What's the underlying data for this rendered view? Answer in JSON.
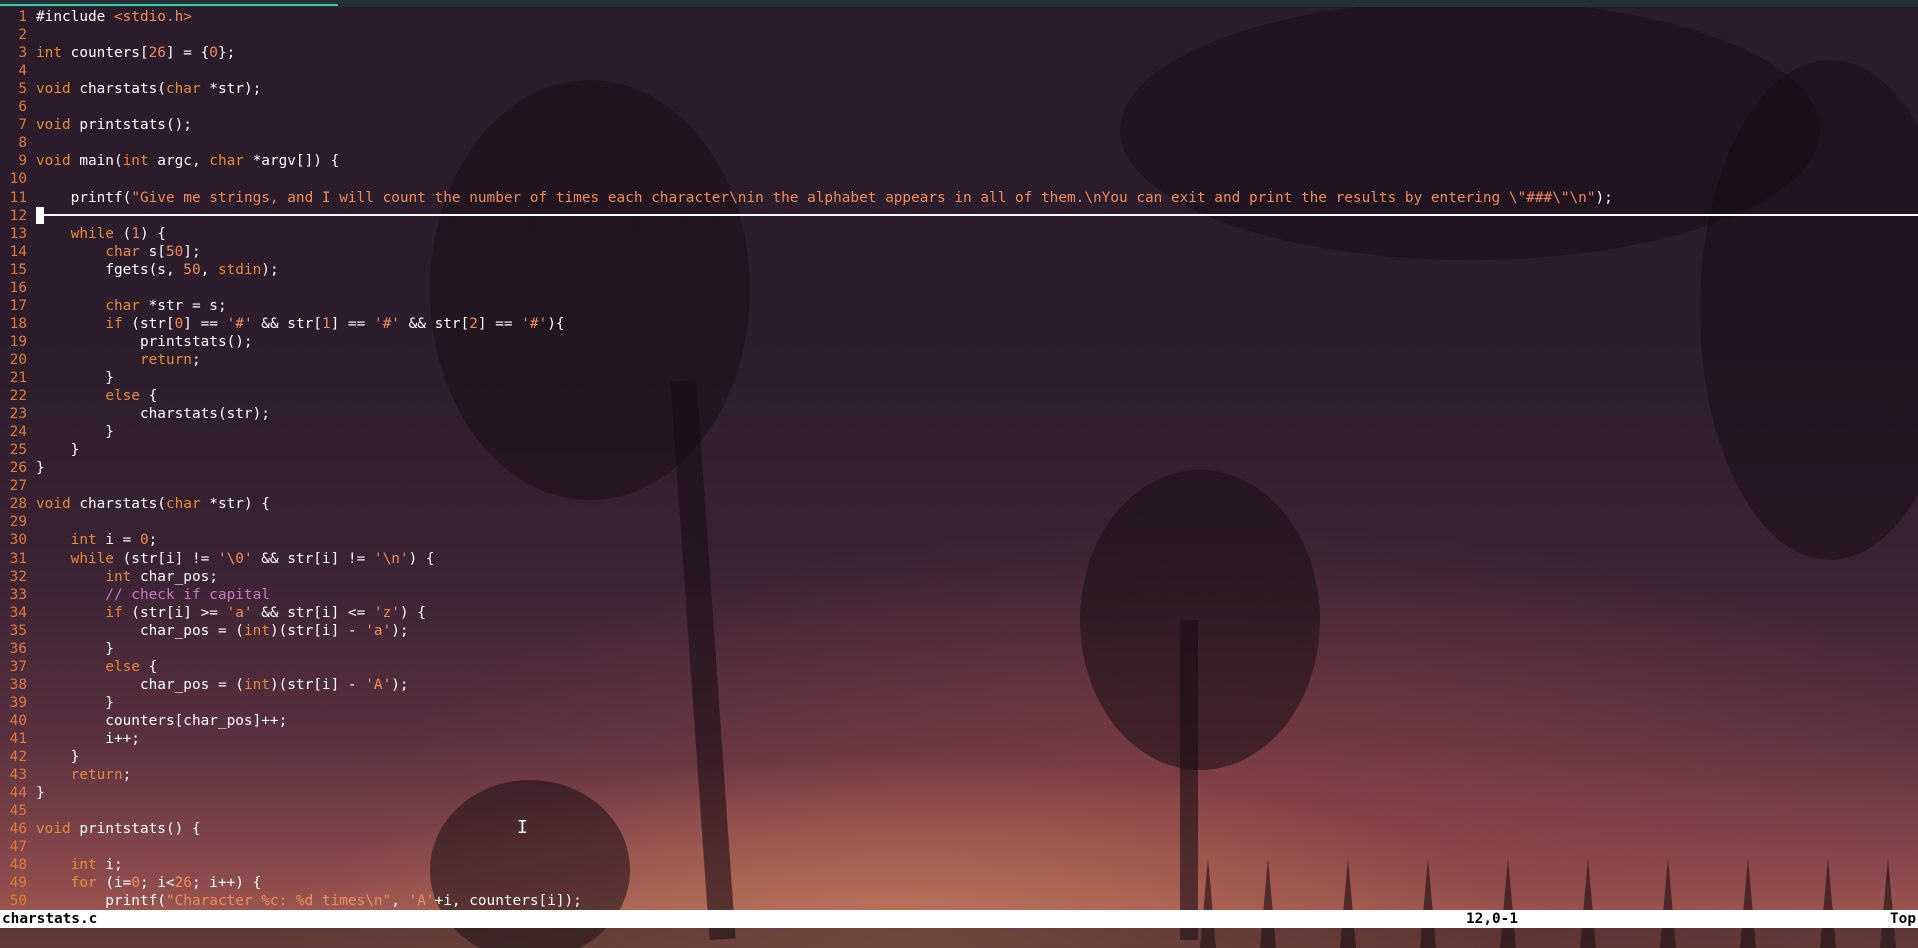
{
  "editor": {
    "lines": [
      {
        "n": "1",
        "segs": [
          [
            "code",
            "#include "
          ],
          [
            "str",
            "<stdio.h>"
          ]
        ]
      },
      {
        "n": "2",
        "segs": []
      },
      {
        "n": "3",
        "segs": [
          [
            "kw",
            "int"
          ],
          [
            "code",
            " counters["
          ],
          [
            "num",
            "26"
          ],
          [
            "code",
            "] = {"
          ],
          [
            "num",
            "0"
          ],
          [
            "code",
            "};"
          ]
        ]
      },
      {
        "n": "4",
        "segs": []
      },
      {
        "n": "5",
        "segs": [
          [
            "kw",
            "void"
          ],
          [
            "code",
            " charstats("
          ],
          [
            "kw",
            "char"
          ],
          [
            "code",
            " *str);"
          ]
        ]
      },
      {
        "n": "6",
        "segs": []
      },
      {
        "n": "7",
        "segs": [
          [
            "kw",
            "void"
          ],
          [
            "code",
            " printstats();"
          ]
        ]
      },
      {
        "n": "8",
        "segs": []
      },
      {
        "n": "9",
        "segs": [
          [
            "kw",
            "void"
          ],
          [
            "code",
            " main("
          ],
          [
            "kw",
            "int"
          ],
          [
            "code",
            " argc, "
          ],
          [
            "kw",
            "char"
          ],
          [
            "code",
            " *argv[]) {"
          ]
        ]
      },
      {
        "n": "10",
        "segs": []
      },
      {
        "n": "11",
        "segs": [
          [
            "code",
            "    printf("
          ],
          [
            "str",
            "\"Give me strings, and I will count the number of times each character\\nin the alphabet appears in all of them.\\nYou can exit and print the results by entering \\\"###\\\"\\n\""
          ],
          [
            "code",
            ");"
          ]
        ]
      },
      {
        "n": "12",
        "segs": []
      },
      {
        "n": "13",
        "segs": [
          [
            "code",
            "    "
          ],
          [
            "kw",
            "while"
          ],
          [
            "code",
            " ("
          ],
          [
            "num",
            "1"
          ],
          [
            "code",
            ") {"
          ]
        ]
      },
      {
        "n": "14",
        "segs": [
          [
            "code",
            "        "
          ],
          [
            "kw",
            "char"
          ],
          [
            "code",
            " s["
          ],
          [
            "num",
            "50"
          ],
          [
            "code",
            "];"
          ]
        ]
      },
      {
        "n": "15",
        "segs": [
          [
            "code",
            "        fgets(s, "
          ],
          [
            "num",
            "50"
          ],
          [
            "code",
            ", "
          ],
          [
            "kw",
            "stdin"
          ],
          [
            "code",
            ");"
          ]
        ]
      },
      {
        "n": "16",
        "segs": []
      },
      {
        "n": "17",
        "segs": [
          [
            "code",
            "        "
          ],
          [
            "kw",
            "char"
          ],
          [
            "code",
            " *str = s;"
          ]
        ]
      },
      {
        "n": "18",
        "segs": [
          [
            "code",
            "        "
          ],
          [
            "kw",
            "if"
          ],
          [
            "code",
            " (str["
          ],
          [
            "num",
            "0"
          ],
          [
            "code",
            "] == "
          ],
          [
            "str",
            "'#'"
          ],
          [
            "code",
            " && str["
          ],
          [
            "num",
            "1"
          ],
          [
            "code",
            "] == "
          ],
          [
            "str",
            "'#'"
          ],
          [
            "code",
            " && str["
          ],
          [
            "num",
            "2"
          ],
          [
            "code",
            "] == "
          ],
          [
            "str",
            "'#'"
          ],
          [
            "code",
            "){"
          ]
        ]
      },
      {
        "n": "19",
        "segs": [
          [
            "code",
            "            printstats();"
          ]
        ]
      },
      {
        "n": "20",
        "segs": [
          [
            "code",
            "            "
          ],
          [
            "kw",
            "return"
          ],
          [
            "code",
            ";"
          ]
        ]
      },
      {
        "n": "21",
        "segs": [
          [
            "code",
            "        }"
          ]
        ]
      },
      {
        "n": "22",
        "segs": [
          [
            "code",
            "        "
          ],
          [
            "kw",
            "else"
          ],
          [
            "code",
            " {"
          ]
        ]
      },
      {
        "n": "23",
        "segs": [
          [
            "code",
            "            charstats(str);"
          ]
        ]
      },
      {
        "n": "24",
        "segs": [
          [
            "code",
            "        }"
          ]
        ]
      },
      {
        "n": "25",
        "segs": [
          [
            "code",
            "    }"
          ]
        ]
      },
      {
        "n": "26",
        "segs": [
          [
            "code",
            "}"
          ]
        ]
      },
      {
        "n": "27",
        "segs": []
      },
      {
        "n": "28",
        "segs": [
          [
            "kw",
            "void"
          ],
          [
            "code",
            " charstats("
          ],
          [
            "kw",
            "char"
          ],
          [
            "code",
            " *str) {"
          ]
        ]
      },
      {
        "n": "29",
        "segs": []
      },
      {
        "n": "30",
        "segs": [
          [
            "code",
            "    "
          ],
          [
            "kw",
            "int"
          ],
          [
            "code",
            " i = "
          ],
          [
            "num",
            "0"
          ],
          [
            "code",
            ";"
          ]
        ]
      },
      {
        "n": "31",
        "segs": [
          [
            "code",
            "    "
          ],
          [
            "kw",
            "while"
          ],
          [
            "code",
            " (str[i] != "
          ],
          [
            "str",
            "'\\0'"
          ],
          [
            "code",
            " && str[i] != "
          ],
          [
            "str",
            "'\\n'"
          ],
          [
            "code",
            ") {"
          ]
        ]
      },
      {
        "n": "32",
        "segs": [
          [
            "code",
            "        "
          ],
          [
            "kw",
            "int"
          ],
          [
            "code",
            " char_pos;"
          ]
        ]
      },
      {
        "n": "33",
        "segs": [
          [
            "cm",
            "        // check if capital"
          ]
        ]
      },
      {
        "n": "34",
        "segs": [
          [
            "code",
            "        "
          ],
          [
            "kw",
            "if"
          ],
          [
            "code",
            " (str[i] >= "
          ],
          [
            "str",
            "'a'"
          ],
          [
            "code",
            " && str[i] <= "
          ],
          [
            "str",
            "'z'"
          ],
          [
            "code",
            ") {"
          ]
        ]
      },
      {
        "n": "35",
        "segs": [
          [
            "code",
            "            char_pos = ("
          ],
          [
            "kw",
            "int"
          ],
          [
            "code",
            ")(str[i] - "
          ],
          [
            "str",
            "'a'"
          ],
          [
            "code",
            ");"
          ]
        ]
      },
      {
        "n": "36",
        "segs": [
          [
            "code",
            "        }"
          ]
        ]
      },
      {
        "n": "37",
        "segs": [
          [
            "code",
            "        "
          ],
          [
            "kw",
            "else"
          ],
          [
            "code",
            " {"
          ]
        ]
      },
      {
        "n": "38",
        "segs": [
          [
            "code",
            "            char_pos = ("
          ],
          [
            "kw",
            "int"
          ],
          [
            "code",
            ")(str[i] - "
          ],
          [
            "str",
            "'A'"
          ],
          [
            "code",
            ");"
          ]
        ]
      },
      {
        "n": "39",
        "segs": [
          [
            "code",
            "        }"
          ]
        ]
      },
      {
        "n": "40",
        "segs": [
          [
            "code",
            "        counters[char_pos]++;"
          ]
        ]
      },
      {
        "n": "41",
        "segs": [
          [
            "code",
            "        i++;"
          ]
        ]
      },
      {
        "n": "42",
        "segs": [
          [
            "code",
            "    }"
          ]
        ]
      },
      {
        "n": "43",
        "segs": [
          [
            "code",
            "    "
          ],
          [
            "kw",
            "return"
          ],
          [
            "code",
            ";"
          ]
        ]
      },
      {
        "n": "44",
        "segs": [
          [
            "code",
            "}"
          ]
        ]
      },
      {
        "n": "45",
        "segs": []
      },
      {
        "n": "46",
        "segs": [
          [
            "kw",
            "void"
          ],
          [
            "code",
            " printstats() {"
          ]
        ]
      },
      {
        "n": "47",
        "segs": []
      },
      {
        "n": "48",
        "segs": [
          [
            "code",
            "    "
          ],
          [
            "kw",
            "int"
          ],
          [
            "code",
            " i;"
          ]
        ]
      },
      {
        "n": "49",
        "segs": [
          [
            "code",
            "    "
          ],
          [
            "kw",
            "for"
          ],
          [
            "code",
            " (i="
          ],
          [
            "num",
            "0"
          ],
          [
            "code",
            "; i<"
          ],
          [
            "num",
            "26"
          ],
          [
            "code",
            "; i++) {"
          ]
        ]
      },
      {
        "n": "50",
        "segs": [
          [
            "code",
            "        printf("
          ],
          [
            "str",
            "\"Character %c: %d times\\n\""
          ],
          [
            "code",
            ", "
          ],
          [
            "str",
            "'A'"
          ],
          [
            "code",
            "+i, counters[i]);"
          ]
        ]
      }
    ]
  },
  "status": {
    "filename": "charstats.c",
    "position": "12,0-1",
    "scroll": "Top"
  },
  "colors": {
    "keyword": "#e58a3a",
    "string": "#f08a5a",
    "comment": "#c978c9",
    "line_number": "#e07a3a"
  }
}
